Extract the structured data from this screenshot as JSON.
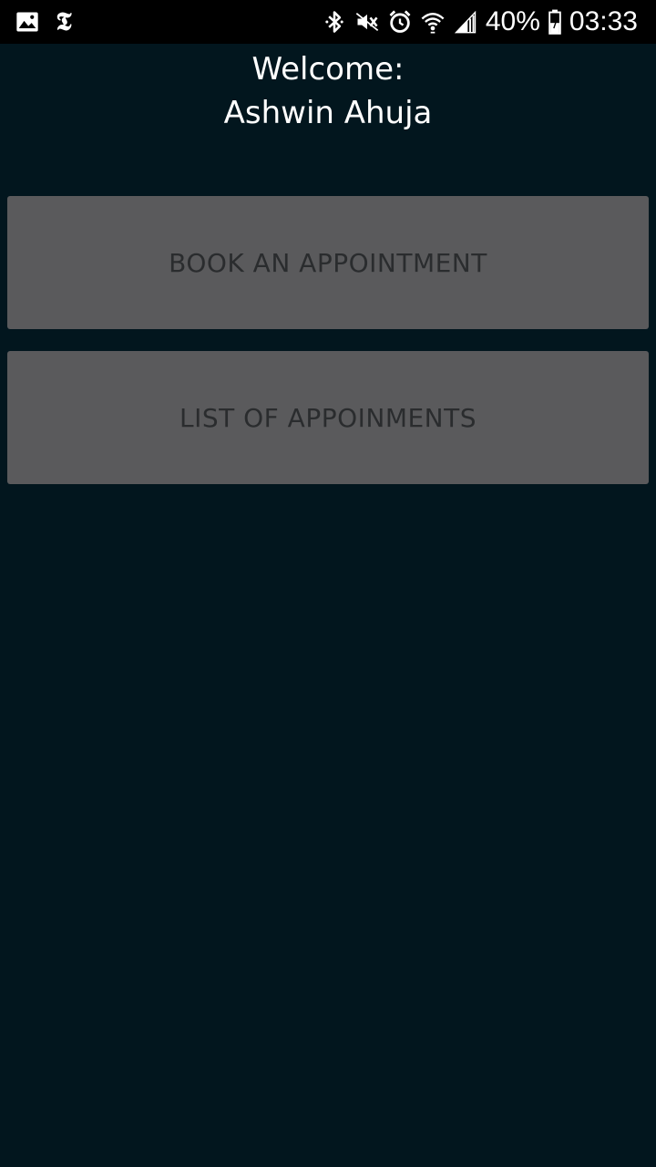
{
  "status_bar": {
    "left_icons": [
      "gallery-icon",
      "nyt-icon"
    ],
    "nyt_glyph": "𝕿",
    "right_icons": [
      "bluetooth-icon",
      "mute-vibrate-icon",
      "alarm-icon",
      "wifi-icon",
      "signal-icon",
      "battery-icon"
    ],
    "battery_percent": "40%",
    "time": "03:33"
  },
  "header": {
    "welcome_label": "Welcome:",
    "user_name": "Ashwin Ahuja"
  },
  "actions": {
    "book_label": "BOOK AN APPOINTMENT",
    "list_label": "LIST OF APPOINMENTS"
  },
  "colors": {
    "background": "#02161e",
    "button": "#5a5a5c",
    "button_text": "#2a2c2e",
    "status_bar": "#000000"
  }
}
